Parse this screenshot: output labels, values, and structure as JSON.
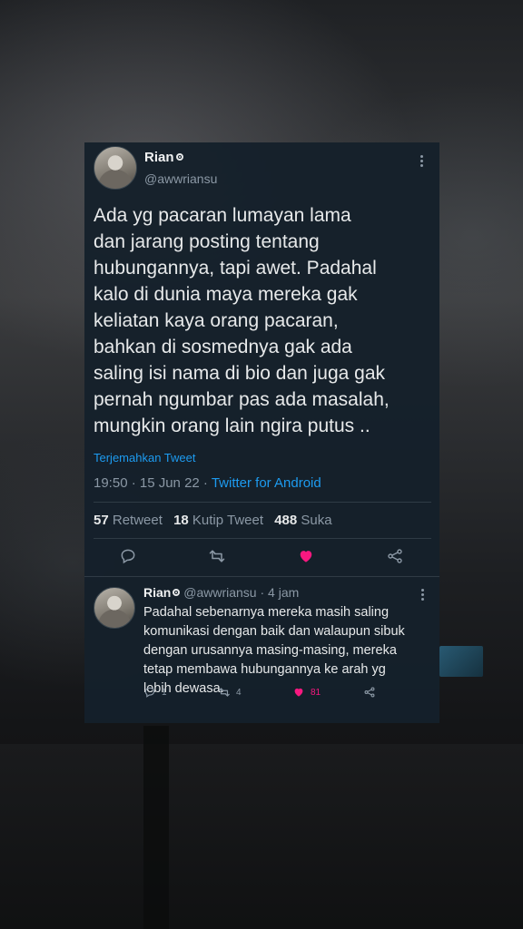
{
  "tweet": {
    "author_name": "Rian",
    "author_handle": "@awwriansu",
    "text": "Ada yg pacaran lumayan lama\ndan jarang posting tentang\nhubungannya, tapi awet. Padahal\nkalo di dunia maya mereka gak\nkeliatan kaya orang pacaran,\nbahkan di sosmednya gak ada\nsaling isi nama di bio dan juga gak\npernah ngumbar pas ada masalah,\nmungkin orang lain ngira putus ..",
    "translate_label": "Terjemahkan Tweet",
    "time_date": "19:50 · 15 Jun 22 · ",
    "source": "Twitter for Android",
    "stats": {
      "retweets_count": "57",
      "retweets_label": "Retweet",
      "quotes_count": "18",
      "quotes_label": "Kutip Tweet",
      "likes_count": "488",
      "likes_label": "Suka"
    }
  },
  "reply": {
    "author_name": "Rian",
    "author_handle": "@awwriansu",
    "age": "· 4 jam",
    "text": "Padahal sebenarnya mereka masih saling\nkomunikasi dengan baik dan walaupun sibuk\ndengan urusannya masing-masing, mereka\ntetap membawa hubungannya ke arah yg\nlebih dewasa.",
    "reply_count": "1",
    "retweet_count": "4",
    "like_count": "81"
  },
  "colors": {
    "card_bg": "#15202b",
    "text": "#e7e9ea",
    "muted": "#8b98a5",
    "link": "#1d9bf0",
    "like": "#f91880"
  },
  "icons": [
    "badge-icon",
    "more-icon",
    "reply-icon",
    "retweet-icon",
    "heart-icon",
    "share-icon"
  ]
}
